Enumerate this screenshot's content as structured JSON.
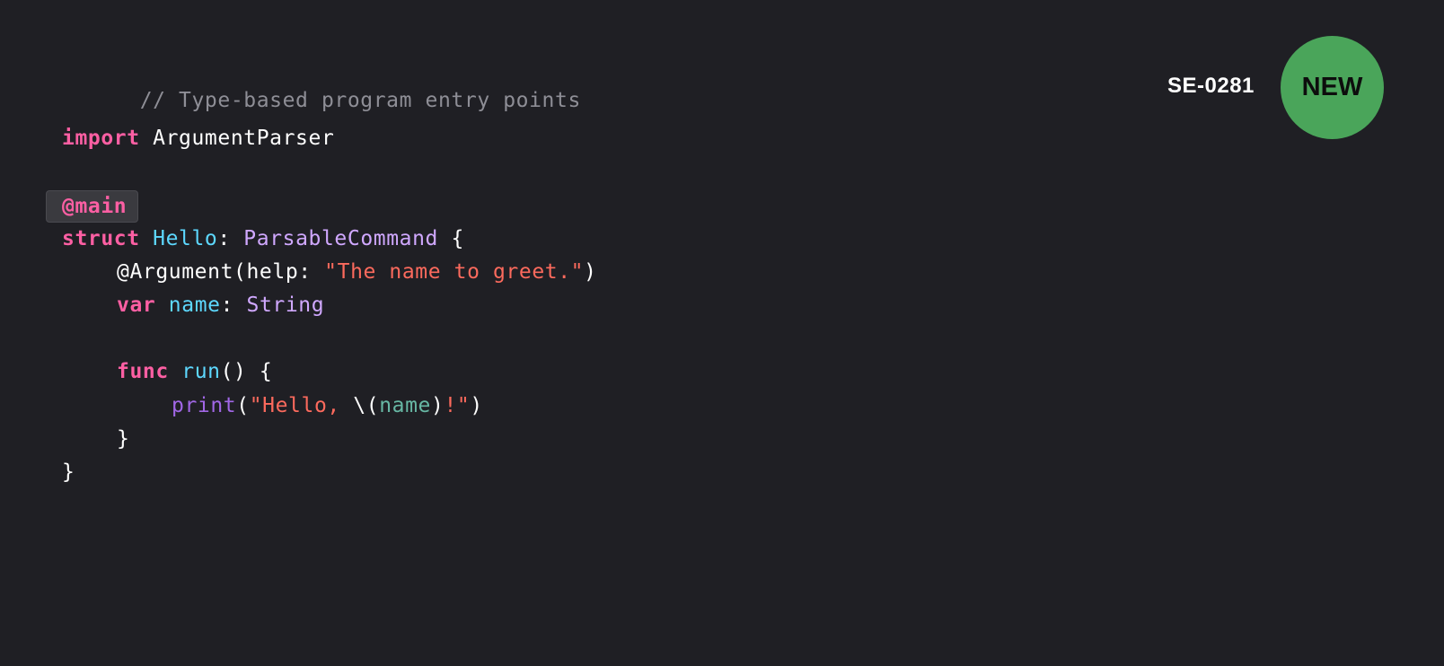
{
  "proposal_tag": "SE-0281",
  "badge_label": "NEW",
  "code": {
    "comment": "// Type-based program entry points",
    "import_kw": "import",
    "import_module": " ArgumentParser",
    "attr_main": "@main",
    "struct_kw": "struct",
    "struct_name": "Hello",
    "colon1": ": ",
    "protocol": "ParsableCommand",
    "open_brace": " {",
    "argument_attr": "@Argument",
    "argument_open": "(help: ",
    "help_string": "\"The name to greet.\"",
    "argument_close": ")",
    "var_kw": "var",
    "var_name": "name",
    "colon2": ": ",
    "var_type": "String",
    "func_kw": "func",
    "func_name": "run",
    "func_sig": "() {",
    "print_fn": "print",
    "paren_open": "(",
    "print_str_start": "\"Hello, ",
    "interp_open": "\\(",
    "interp_var": "name",
    "interp_close": ")",
    "print_str_end": "!\"",
    "paren_close": ")",
    "inner_close": "}",
    "outer_close": "}"
  }
}
